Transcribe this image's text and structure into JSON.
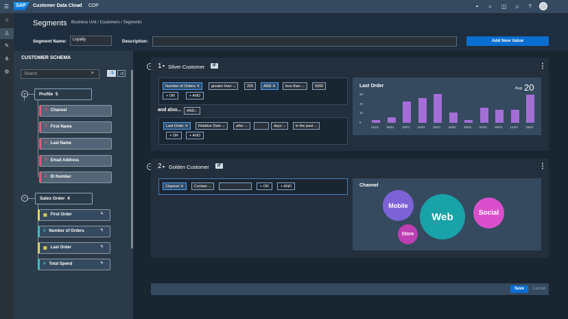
{
  "shell": {
    "logo": "SAP",
    "title": "Customer Data Cloud",
    "caret": "▾",
    "sub": "CDP"
  },
  "header": {
    "title": "Segments",
    "breadcrumb": "Business Unit / Customers / Segments",
    "seg_name_label": "Segment Name:",
    "seg_name_value": "Loyalty",
    "desc_label": "Description:",
    "add_button": "Add New Value"
  },
  "schema": {
    "title": "CUSTOMER SCHEMA",
    "search_placeholder": "Search",
    "profile": {
      "label": "Profile",
      "count": "5",
      "items": [
        {
          "icon": "T",
          "label": "Channel"
        },
        {
          "icon": "T",
          "label": "First Name"
        },
        {
          "icon": "T",
          "label": "Last Name"
        },
        {
          "icon": "T",
          "label": "Email Address"
        },
        {
          "icon": "#",
          "label": "ID Number"
        }
      ]
    },
    "sales": {
      "label": "Sales Order",
      "count": "4",
      "items": [
        {
          "icon": "▦",
          "label": "First Order"
        },
        {
          "icon": "#",
          "label": "Number of Orders"
        },
        {
          "icon": "▦",
          "label": "Last Order"
        },
        {
          "icon": "#",
          "label": "Total Spend"
        }
      ]
    }
  },
  "seg1": {
    "num": "1",
    "name": "Silver Customer",
    "if": "IF",
    "row1": [
      "Number of Orders",
      "greater than",
      "200",
      "AND",
      "less than",
      "5000"
    ],
    "or": "+ OR",
    "and": "+ AND",
    "also": "and also...",
    "also_sel": "AND",
    "row2": [
      "Last Order",
      "Relative Date",
      "after",
      "",
      "days",
      "in the past"
    ],
    "chart": {
      "title": "Last Order",
      "month": "Aug",
      "day": "20"
    }
  },
  "seg2": {
    "num": "2",
    "name": "Golden Customer",
    "if": "IF",
    "row1": [
      "Channel",
      "Contain",
      ""
    ],
    "or": "+ OR",
    "and": "+ AND",
    "panel_title": "Channel",
    "bubbles": [
      "Mobile",
      "Web",
      "Social",
      "Store"
    ]
  },
  "footer": {
    "save": "Save",
    "cancel": "Cancel"
  },
  "chart_data": {
    "type": "bar",
    "title": "Last Order",
    "categories": [
      "01/01",
      "05/01",
      "10/01",
      "15/01",
      "20/01",
      "25/01",
      "30/01",
      "04/02",
      "09/02",
      "14/02",
      "19/02"
    ],
    "values": [
      3,
      6,
      23,
      26,
      31,
      11,
      3,
      16,
      14,
      14,
      30
    ],
    "ylim": [
      0,
      30
    ],
    "yticks": [
      0,
      10,
      20,
      30
    ]
  }
}
